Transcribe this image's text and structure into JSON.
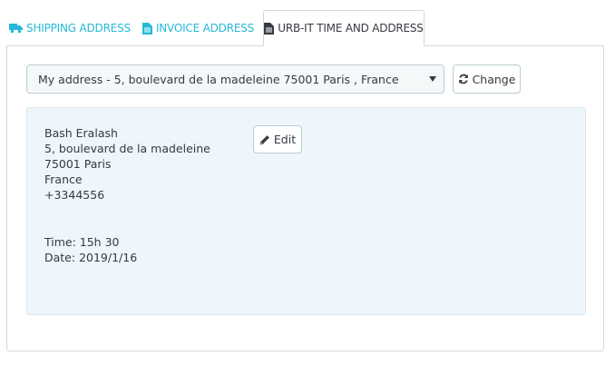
{
  "tabs": [
    {
      "label": "SHIPPING ADDRESS",
      "icon": "truck-icon"
    },
    {
      "label": "INVOICE ADDRESS",
      "icon": "file-text-icon"
    },
    {
      "label": "URB-IT TIME AND ADDRESS",
      "icon": "file-icon",
      "active": true
    }
  ],
  "address_select": {
    "selected": "My address - 5, boulevard de la madeleine 75001 Paris , France"
  },
  "change_button": {
    "label": "Change",
    "icon": "refresh-icon"
  },
  "address_card": {
    "lines": [
      "Bash Eralash",
      "5, boulevard de la madeleine",
      "75001 Paris",
      "France",
      "+3344556"
    ],
    "edit_button": {
      "label": "Edit",
      "icon": "pencil-icon"
    },
    "time": "Time: 15h 30",
    "date": "Date: 2019/1/16"
  },
  "colors": {
    "accent": "#25b9d7",
    "text": "#363a41",
    "card_background": "#eef5fb",
    "border": "#d3d8db"
  }
}
